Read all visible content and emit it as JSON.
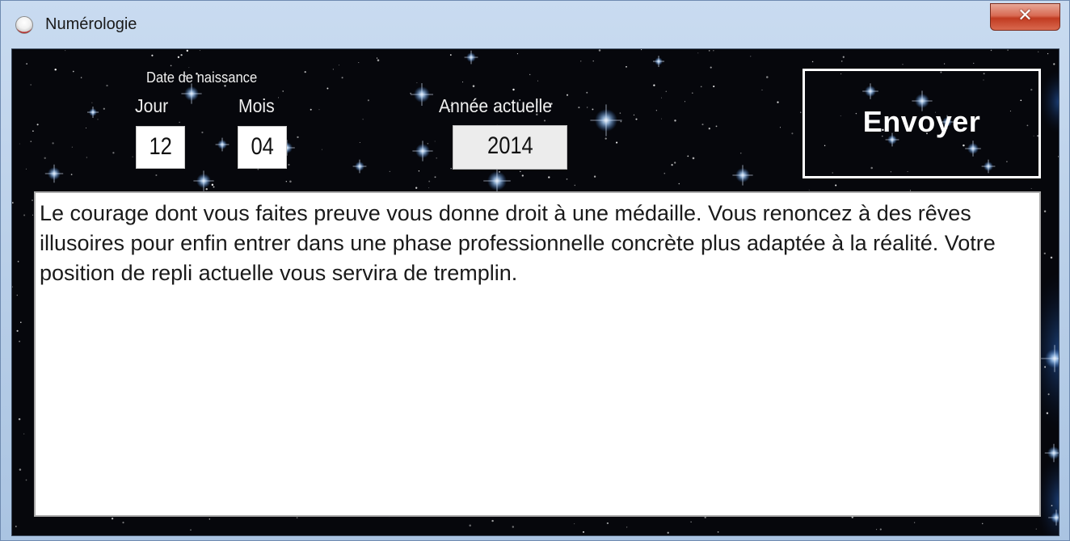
{
  "window": {
    "title": "Numérologie",
    "close_glyph": "✕"
  },
  "form": {
    "birth_date_label": "Date de naissance",
    "day_label": "Jour",
    "month_label": "Mois",
    "day_value": "12",
    "month_value": "04",
    "current_year_label": "Année actuelle",
    "current_year_value": "2014",
    "submit_label": "Envoyer"
  },
  "result": {
    "text": "Le courage dont vous faites preuve vous donne droit à une médaille. Vous renoncez à des rêves illusoires pour enfin entrer dans une phase professionnelle concrète plus adaptée à la réalité. Votre position de repli actuelle vous servira de tremplin."
  },
  "colors": {
    "background": "#06070c",
    "text_light": "#f0f0f0",
    "close_button": "#c13b21"
  },
  "icons": {
    "app": "app-icon",
    "close": "close-icon"
  }
}
